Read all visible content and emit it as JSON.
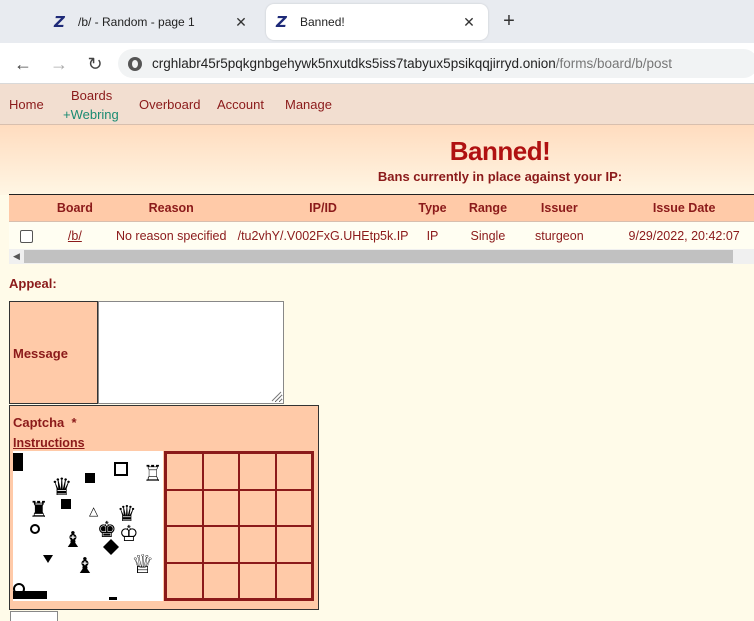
{
  "browser": {
    "tabs": [
      {
        "title": "/b/ - Random - page 1",
        "active": false
      },
      {
        "title": "Banned!",
        "active": true
      }
    ],
    "favicon_glyph": "Z",
    "close_glyph": "✕",
    "new_tab_glyph": "+",
    "url_host": "crghlabr45r5pqkgnbgehywk5nxutdks5iss7tabyux5psikqqjirryd.onion",
    "url_path": "/forms/board/b/post"
  },
  "site_nav": {
    "home": "Home",
    "boards": "Boards",
    "webring": "+Webring",
    "overboard": "Overboard",
    "account": "Account",
    "manage": "Manage"
  },
  "page": {
    "title": "Banned!",
    "subtitle": "Bans currently in place against your IP:"
  },
  "ban_table": {
    "headers": [
      "Board",
      "Reason",
      "IP/ID",
      "Type",
      "Range",
      "Issuer",
      "Issue Date"
    ],
    "rows": [
      {
        "board": "/b/",
        "reason": "No reason specified",
        "ip_id": "/tu2vhY/.V002FxG.UHEtp5k.IP",
        "type": "IP",
        "range": "Single",
        "issuer": "sturgeon",
        "issue_date": "9/29/2022, 20:42:07"
      }
    ]
  },
  "appeal": {
    "label": "Appeal:",
    "message_label": "Message",
    "message_value": "",
    "captcha_label": "Captcha",
    "captcha_required_mark": "*",
    "captcha_instructions": "Instructions"
  },
  "colors": {
    "accent": "#8b1a1a",
    "title_red": "#b01111",
    "cell_peach": "#ffcaa8",
    "nav_bg": "#f2ded0",
    "webring_green": "#1a8b72"
  }
}
